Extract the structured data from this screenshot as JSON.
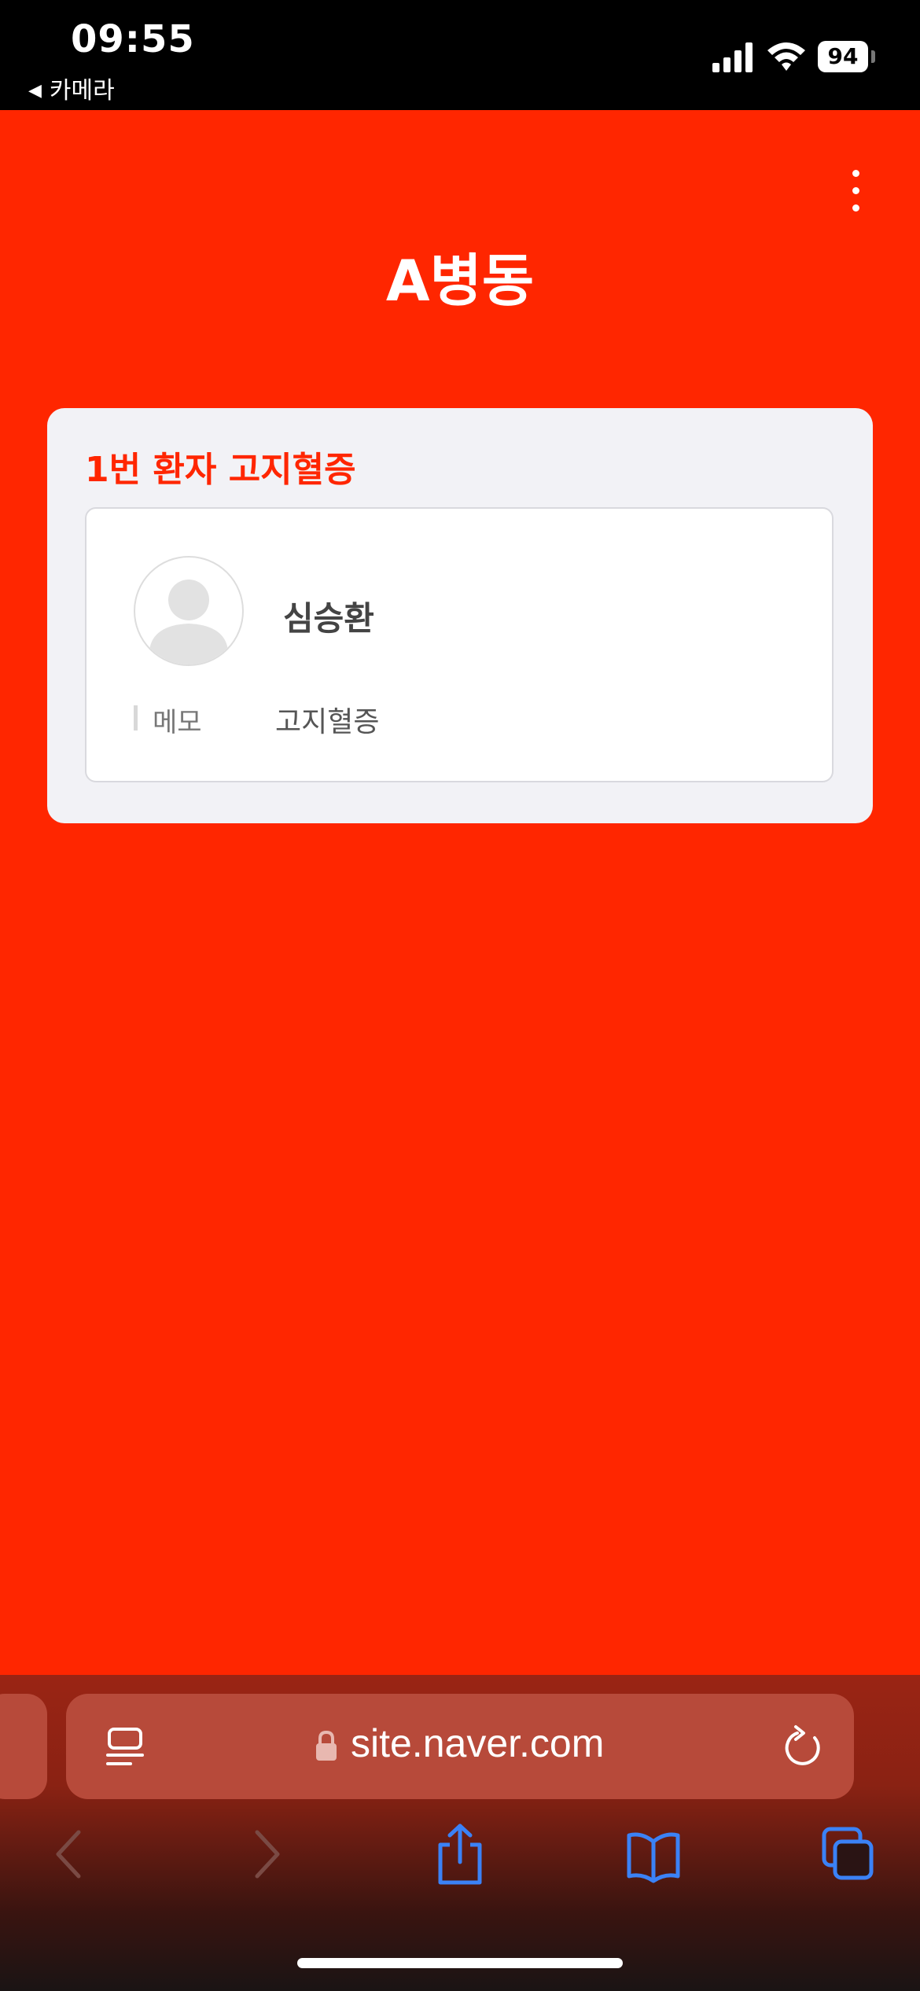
{
  "status_bar": {
    "time": "09:55",
    "back_label": "카메라",
    "battery": "94"
  },
  "header": {
    "title": "A병동"
  },
  "card": {
    "title": "1번 환자 고지혈증",
    "patient": {
      "name": "심승환",
      "memo_label": "메모",
      "memo_value": "고지혈증"
    }
  },
  "browser": {
    "url": "site.naver.com"
  },
  "colors": {
    "accent": "#ff2600",
    "card_bg": "#f2f2f6",
    "toolbar_icon": "#3b82f6"
  }
}
